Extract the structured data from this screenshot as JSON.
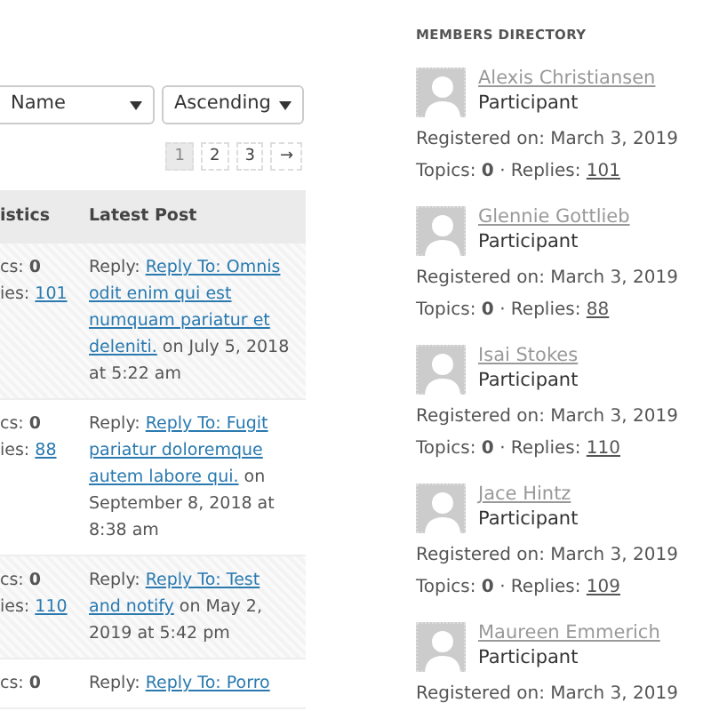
{
  "sort": {
    "field": "Name",
    "order": "Ascending"
  },
  "pagination": [
    {
      "label": "1",
      "selected": true
    },
    {
      "label": "2",
      "selected": false
    },
    {
      "label": "3",
      "selected": false
    },
    {
      "label": "→",
      "selected": false
    }
  ],
  "table": {
    "columns": [
      "istics",
      "Latest Post"
    ],
    "rows": [
      {
        "topics_label": "cs:",
        "topics": "0",
        "replies_label": "ies:",
        "replies": "101",
        "prefix": "Reply:",
        "link": "Reply To: Omnis odit enim qui est numquam pariatur et deleniti.",
        "suffix": "on July 5, 2018 at 5:22 am"
      },
      {
        "topics_label": "cs:",
        "topics": "0",
        "replies_label": "ies:",
        "replies": "88",
        "prefix": "Reply:",
        "link": "Reply To: Fugit pariatur doloremque autem labore qui.",
        "suffix": "on September 8, 2018 at 8:38 am"
      },
      {
        "topics_label": "cs:",
        "topics": "0",
        "replies_label": "ies:",
        "replies": "110",
        "prefix": "Reply:",
        "link": "Reply To: Test and notify",
        "suffix": "on May 2, 2019 at 5:42 pm"
      },
      {
        "topics_label": "cs:",
        "topics": "0",
        "prefix": "Reply:",
        "link": "Reply To: Porro"
      }
    ]
  },
  "members_directory": {
    "title": "MEMBERS DIRECTORY",
    "members": [
      {
        "name": "Alexis Christiansen",
        "role": "Participant",
        "registered": "Registered on: March 3, 2019",
        "topics_label": "Topics:",
        "topics": "0",
        "replies_label": "· Replies:",
        "replies": "101"
      },
      {
        "name": "Glennie Gottlieb",
        "role": "Participant",
        "registered": "Registered on: March 3, 2019",
        "topics_label": "Topics:",
        "topics": "0",
        "replies_label": "· Replies:",
        "replies": "88"
      },
      {
        "name": "Isai Stokes",
        "role": "Participant",
        "registered": "Registered on: March 3, 2019",
        "topics_label": "Topics:",
        "topics": "0",
        "replies_label": "· Replies:",
        "replies": "110"
      },
      {
        "name": "Jace Hintz",
        "role": "Participant",
        "registered": "Registered on: March 3, 2019",
        "topics_label": "Topics:",
        "topics": "0",
        "replies_label": "· Replies:",
        "replies": "109"
      },
      {
        "name": "Maureen Emmerich",
        "role": "Participant",
        "registered": "Registered on: March 3, 2019"
      }
    ]
  }
}
